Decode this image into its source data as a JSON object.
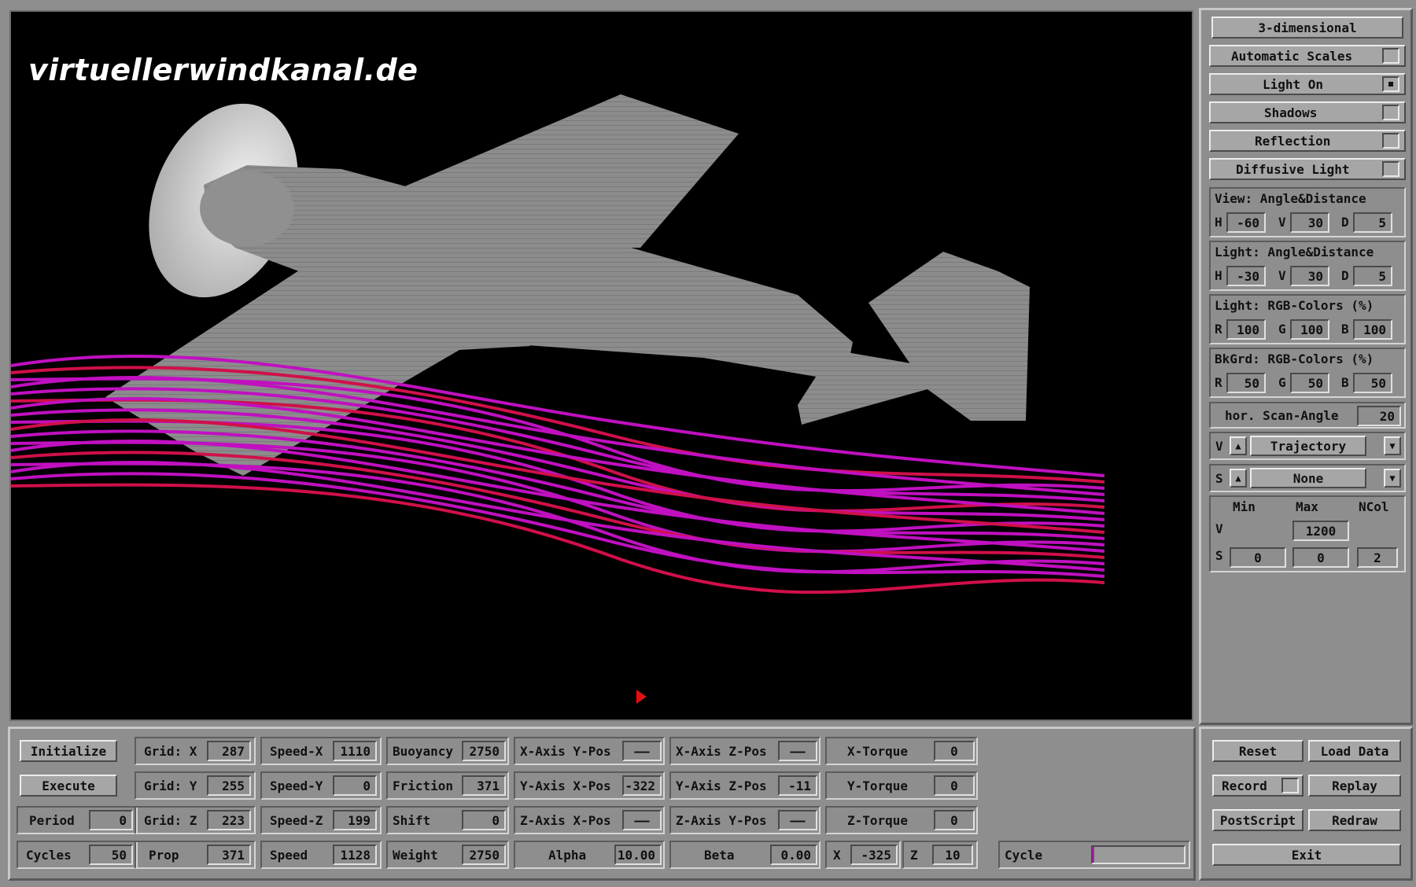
{
  "watermark": "virtuellerwindkanal.de",
  "colors": {
    "streamline": "#c010c0",
    "streamline_mid": "#d0104a",
    "model": "#8a8a8a",
    "background": "#000000"
  },
  "right": {
    "mode_button": "3-dimensional",
    "toggles": [
      {
        "label": "Automatic Scales",
        "checked": false
      },
      {
        "label": "Light On",
        "checked": true
      },
      {
        "label": "Shadows",
        "checked": false
      },
      {
        "label": "Reflection",
        "checked": false
      },
      {
        "label": "Diffusive Light",
        "checked": false
      }
    ],
    "view": {
      "title": "View:  Angle&Distance",
      "h_label": "H",
      "h": "-60",
      "v_label": "V",
      "v": "30",
      "d_label": "D",
      "d": "5"
    },
    "light_angle": {
      "title": "Light: Angle&Distance",
      "h_label": "H",
      "h": "-30",
      "v_label": "V",
      "v": "30",
      "d_label": "D",
      "d": "5"
    },
    "light_rgb": {
      "title": "Light: RGB-Colors (%)",
      "r_label": "R",
      "r": "100",
      "g_label": "G",
      "g": "100",
      "b_label": "B",
      "b": "100"
    },
    "bkgrd_rgb": {
      "title": "BkGrd: RGB-Colors (%)",
      "r_label": "R",
      "r": "50",
      "g_label": "G",
      "g": "50",
      "b_label": "B",
      "b": "50"
    },
    "scan": {
      "label": "hor. Scan-Angle",
      "value": "20"
    },
    "v_select": {
      "prefix": "V",
      "value": "Trajectory"
    },
    "s_select": {
      "prefix": "S",
      "value": "None"
    },
    "scale": {
      "min_label": "Min",
      "max_label": "Max",
      "ncol_label": "NCol",
      "v_label": "V",
      "v_max": "1200",
      "s_label": "S",
      "s_min": "0",
      "s_max": "0",
      "s_ncol": "2"
    }
  },
  "bottom": {
    "initialize": "Initialize",
    "execute": "Execute",
    "period": {
      "label": "Period",
      "value": "0"
    },
    "cycles": {
      "label": "Cycles",
      "value": "50"
    },
    "grid_x": {
      "label": "Grid: X",
      "value": "287"
    },
    "grid_y": {
      "label": "Grid: Y",
      "value": "255"
    },
    "grid_z": {
      "label": "Grid: Z",
      "value": "223"
    },
    "prop": {
      "label": "Prop",
      "value": "371"
    },
    "speed_x": {
      "label": "Speed-X",
      "value": "1110"
    },
    "speed_y": {
      "label": "Speed-Y",
      "value": "0"
    },
    "speed_z": {
      "label": "Speed-Z",
      "value": "199"
    },
    "speed": {
      "label": "Speed",
      "value": "1128"
    },
    "buoyancy": {
      "label": "Buoyancy",
      "value": "2750"
    },
    "friction": {
      "label": "Friction",
      "value": "371"
    },
    "shift": {
      "label": "Shift",
      "value": "0"
    },
    "weight": {
      "label": "Weight",
      "value": "2750"
    },
    "xaxis_ypos": {
      "label": "X-Axis Y-Pos",
      "value": "——"
    },
    "yaxis_xpos": {
      "label": "Y-Axis X-Pos",
      "value": "-322"
    },
    "zaxis_xpos": {
      "label": "Z-Axis X-Pos",
      "value": "——"
    },
    "alpha": {
      "label": "Alpha",
      "value": "10.00"
    },
    "xaxis_zpos": {
      "label": "X-Axis Z-Pos",
      "value": "——"
    },
    "yaxis_zpos": {
      "label": "Y-Axis Z-Pos",
      "value": "-11"
    },
    "zaxis_ypos": {
      "label": "Z-Axis Y-Pos",
      "value": "——"
    },
    "beta": {
      "label": "Beta",
      "value": "0.00"
    },
    "x_torque": {
      "label": "X-Torque",
      "value": "0"
    },
    "y_torque": {
      "label": "Y-Torque",
      "value": "0"
    },
    "z_torque": {
      "label": "Z-Torque",
      "value": "0"
    },
    "x": {
      "label": "X",
      "value": "-325"
    },
    "z": {
      "label": "Z",
      "value": "10"
    },
    "cycle": {
      "label": "Cycle",
      "progress": 0.02
    }
  },
  "actions": {
    "reset": "Reset",
    "load_data": "Load Data",
    "record": "Record",
    "replay": "Replay",
    "postscript": "PostScript",
    "redraw": "Redraw",
    "exit": "Exit"
  }
}
